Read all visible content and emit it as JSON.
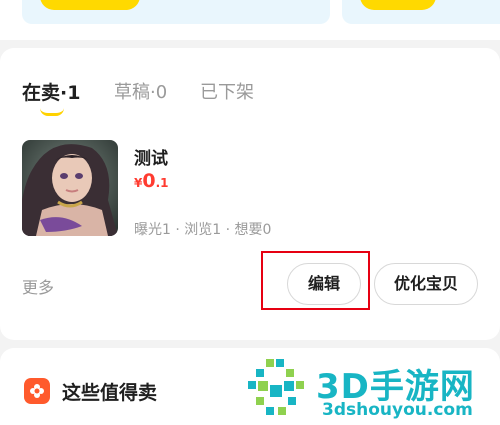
{
  "tabs": {
    "on_sale": "在卖·1",
    "drafts": "草稿·0",
    "off_shelf": "已下架"
  },
  "product": {
    "title": "测试",
    "price_currency": "¥",
    "price_integer": "0",
    "price_decimal": ".1",
    "stats": "曝光1 · 浏览1 · 想要0"
  },
  "actions": {
    "more": "更多",
    "edit": "编辑",
    "optimize": "优化宝贝"
  },
  "section": {
    "title": "这些值得卖"
  },
  "watermark": {
    "brand": "3D手游网",
    "url": "3dshouyou.com"
  },
  "colors": {
    "accent_yellow": "#ffd900",
    "price_red": "#ff3b30",
    "highlight_red": "#e60012",
    "watermark_teal": "#18b5c4"
  }
}
